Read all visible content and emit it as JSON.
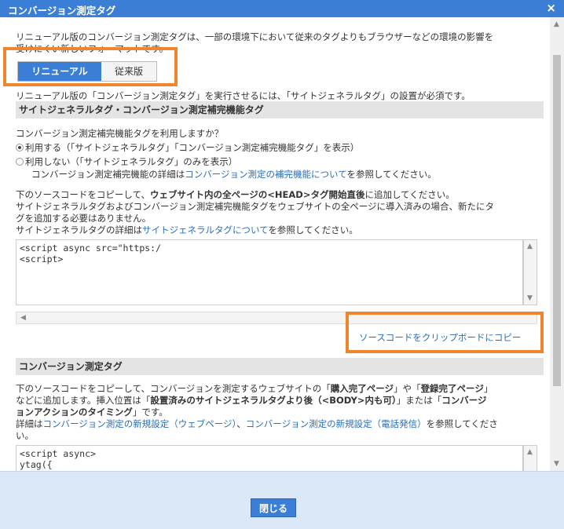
{
  "dialog": {
    "title": "コンバージョン測定タグ",
    "close_symbol": "×"
  },
  "intro": {
    "line1": "リニューアル版のコンバージョン測定タグは、一部の環境下において従来のタグよりもブラウザーなどの環境の影響を",
    "line2": "受けにくい新しいフォーマットです。"
  },
  "tabs": {
    "renewal": "リニューアル版",
    "legacy": "従来版"
  },
  "note": "リニューアル版の「コンバージョン測定タグ」を実行させるには、「サイトジェネラルタグ」の設置が必須です。",
  "section1": {
    "title": "サイトジェネラルタグ・コンバージョン測定補完機能タグ",
    "question": "コンバージョン測定補完機能タグを利用しますか？",
    "option_use": "利用する（「サイトジェネラルタグ」「コンバージョン測定補完機能タグ」を表示）",
    "option_nouse": "利用しない（「サイトジェネラルタグ」のみを表示）",
    "detail_prefix": "コンバージョン測定補完機能の詳細は",
    "detail_link": "コンバージョン測定の補完機能について",
    "detail_suffix": "を参照してください。",
    "copy_prefix": "下のソースコードをコピーして、",
    "copy_bold": "ウェブサイト内の全ページの<HEAD>タグ開始直後",
    "copy_suffix": "に追加してください。",
    "note_line1": "サイトジェネラルタグおよびコンバージョン測定補完機能タグをウェブサイトの全ページに導入済みの場合、新たにタ",
    "note_line2": "グを追加する必要はありません。",
    "general_prefix": "サイトジェネラルタグの詳細は",
    "general_link": "サイトジェネラルタグについて",
    "general_suffix": "を参照してください。",
    "code_line1": "<script async src=\"https:/",
    "code_line2": "<script>",
    "copy_button": "ソースコードをクリップボードにコピー"
  },
  "section2": {
    "title": "コンバージョン測定タグ",
    "p1_a": "下のソースコードをコピーして、コンバージョンを測定するウェブサイトの「",
    "p1_b": "購入完了ページ",
    "p1_c": "」や「",
    "p1_d": "登録完了ページ",
    "p1_e": "」",
    "p2_a": "などに追加します。挿入位置は「",
    "p2_b": "設置済みのサイトジェネラルタグより後（<BODY>内も可）",
    "p2_c": "」または「",
    "p2_d": "コンバージ",
    "p3_a": "ョンアクションのタイミング",
    "p3_b": "」です。",
    "p4_a": "詳細は",
    "p4_link1": "コンバージョン測定の新規設定（ウェブページ）",
    "p4_sep": "、",
    "p4_link2": "コンバージョン測定の新規設定（電話発信）",
    "p4_b": "を参照してくださ",
    "p5": "い。",
    "code_line1": "<script async>",
    "code_line2": "ytag({"
  },
  "footer": {
    "close_button": "閉じる"
  },
  "colors": {
    "accent": "#3a7fd5",
    "highlight": "#f0852c",
    "link": "#2a6ebd"
  }
}
